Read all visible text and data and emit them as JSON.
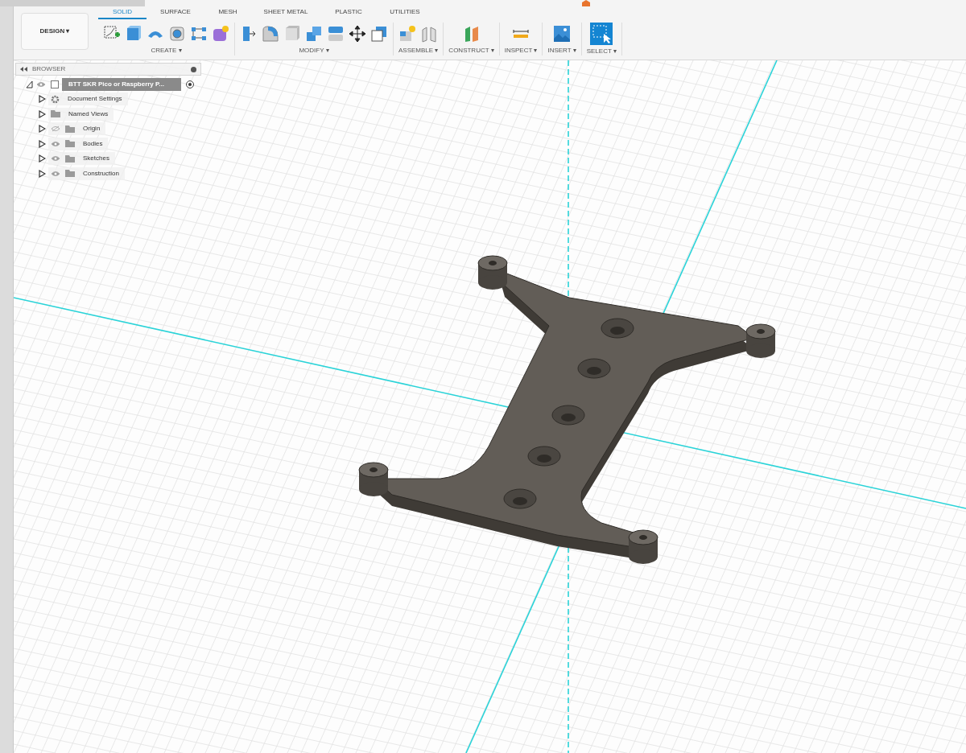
{
  "workspace": {
    "label": "DESIGN ▾"
  },
  "tabs": [
    {
      "label": "SOLID",
      "selected": true
    },
    {
      "label": "SURFACE",
      "selected": false
    },
    {
      "label": "MESH",
      "selected": false
    },
    {
      "label": "SHEET METAL",
      "selected": false
    },
    {
      "label": "PLASTIC",
      "selected": false
    },
    {
      "label": "UTILITIES",
      "selected": false
    }
  ],
  "groups": [
    {
      "kind": "create",
      "label": "CREATE ▾"
    },
    {
      "kind": "modify",
      "label": "MODIFY ▾"
    },
    {
      "kind": "assemble",
      "label": "ASSEMBLE ▾"
    },
    {
      "kind": "construct",
      "label": "CONSTRUCT ▾"
    },
    {
      "kind": "inspect",
      "label": "INSPECT ▾"
    },
    {
      "kind": "insert",
      "label": "INSERT ▾"
    },
    {
      "kind": "select",
      "label": "SELECT ▾"
    }
  ],
  "browser": {
    "title": "BROWSER",
    "root": {
      "label": "BTT SKR Pico or Raspberry P...",
      "expanded": true,
      "active": true,
      "children": [
        {
          "kind": "settings",
          "label": "Document Settings",
          "expanded": false
        },
        {
          "kind": "views",
          "label": "Named Views",
          "expanded": false
        },
        {
          "kind": "folder",
          "label": "Origin",
          "expanded": false,
          "visible": false
        },
        {
          "kind": "folder",
          "label": "Bodies",
          "expanded": false,
          "visible": true
        },
        {
          "kind": "folder",
          "label": "Sketches",
          "expanded": false,
          "visible": true
        },
        {
          "kind": "folder",
          "label": "Construction",
          "expanded": false,
          "visible": true
        }
      ]
    }
  }
}
